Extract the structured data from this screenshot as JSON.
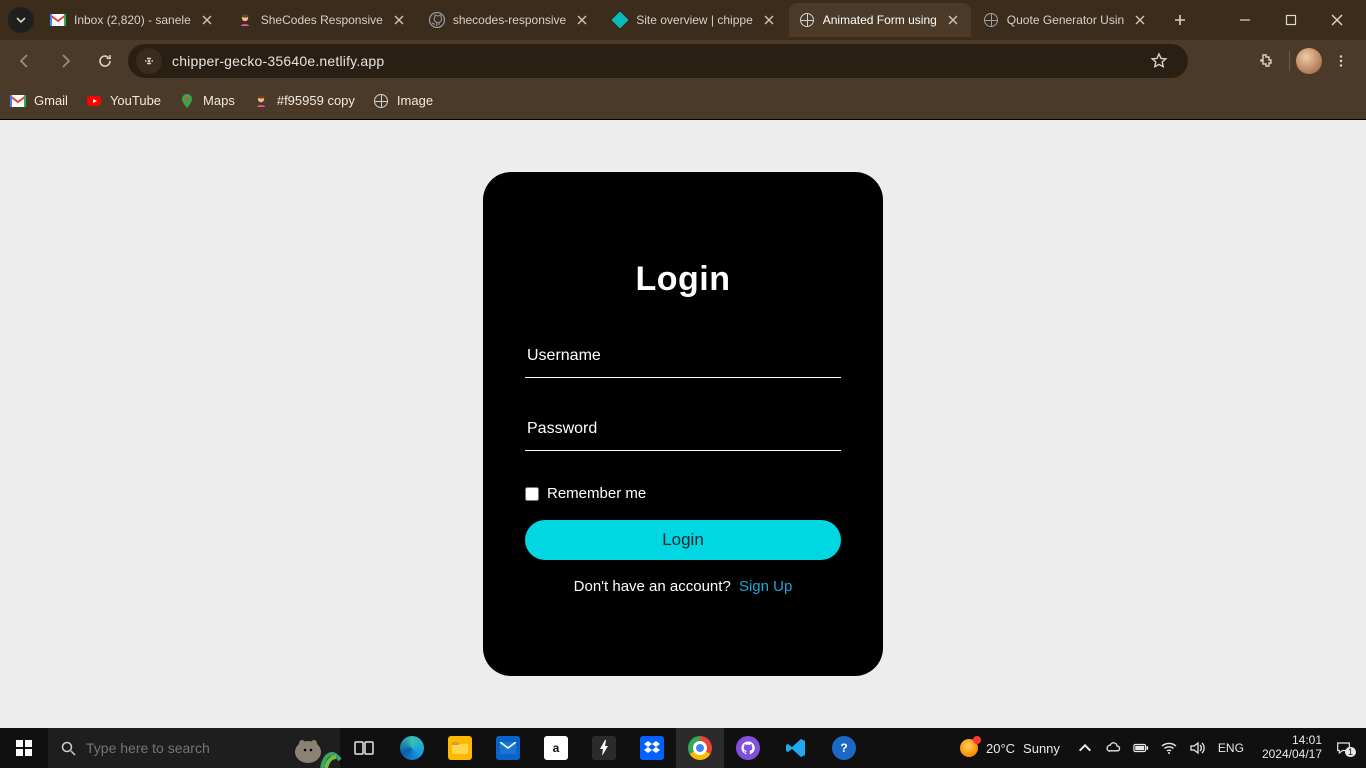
{
  "browser": {
    "tabs": [
      {
        "title": "Inbox (2,820) - sanele",
        "favicon": "gmail"
      },
      {
        "title": "SheCodes Responsive",
        "favicon": "shecodes"
      },
      {
        "title": "shecodes-responsive",
        "favicon": "github"
      },
      {
        "title": "Site overview | chippe",
        "favicon": "netlify"
      },
      {
        "title": "Animated Form using",
        "favicon": "globe",
        "active": true
      },
      {
        "title": "Quote Generator Usin",
        "favicon": "globe"
      }
    ],
    "url": "chipper-gecko-35640e.netlify.app",
    "bookmarks": [
      {
        "label": "Gmail",
        "icon": "gmail"
      },
      {
        "label": "YouTube",
        "icon": "youtube"
      },
      {
        "label": "Maps",
        "icon": "maps"
      },
      {
        "label": "#f95959 copy",
        "icon": "shecodes"
      },
      {
        "label": "Image",
        "icon": "globe"
      }
    ]
  },
  "page": {
    "title": "Login",
    "username_label": "Username",
    "username_value": "",
    "password_label": "Password",
    "password_value": "",
    "remember_label": "Remember me",
    "login_button": "Login",
    "signup_prompt": "Don't have an account?",
    "signup_link": "Sign Up"
  },
  "taskbar": {
    "search_placeholder": "Type here to search",
    "weather_temp": "20°C",
    "weather_desc": "Sunny",
    "language": "ENG",
    "time": "14:01",
    "date": "2024/04/17",
    "notification_count": "1",
    "apps": [
      "task-view",
      "edge",
      "file-explorer",
      "mail",
      "amazon",
      "flash",
      "dropbox",
      "chrome",
      "github-desktop",
      "vscode",
      "help"
    ]
  }
}
